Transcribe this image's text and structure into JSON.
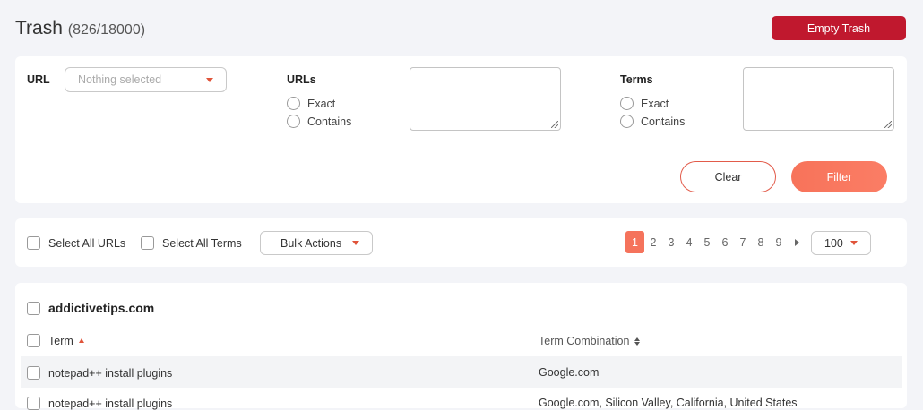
{
  "header": {
    "title": "Trash",
    "count": "(826/18000)",
    "empty_trash_label": "Empty Trash"
  },
  "filter": {
    "url_label": "URL",
    "url_select_placeholder": "Nothing selected",
    "urls_label": "URLs",
    "urls_options": [
      "Exact",
      "Contains"
    ],
    "terms_label": "Terms",
    "terms_options": [
      "Exact",
      "Contains"
    ],
    "clear_label": "Clear",
    "filter_label": "Filter"
  },
  "bulk": {
    "select_all_urls": "Select All URLs",
    "select_all_terms": "Select All Terms",
    "bulk_actions": "Bulk Actions",
    "pages": [
      "1",
      "2",
      "3",
      "4",
      "5",
      "6",
      "7",
      "8",
      "9"
    ],
    "current_page": "1",
    "per_page": "100"
  },
  "table": {
    "domain": "addictivetips.com",
    "columns": [
      "Term",
      "Term Combination"
    ],
    "rows": [
      {
        "term": "notepad++ install plugins",
        "combination": "Google.com"
      },
      {
        "term": "notepad++ install plugins",
        "combination": "Google.com, Silicon Valley, California, United States"
      }
    ]
  },
  "colors": {
    "accent": "#f5735c",
    "danger": "#c0182e",
    "background": "#f3f4f8"
  }
}
